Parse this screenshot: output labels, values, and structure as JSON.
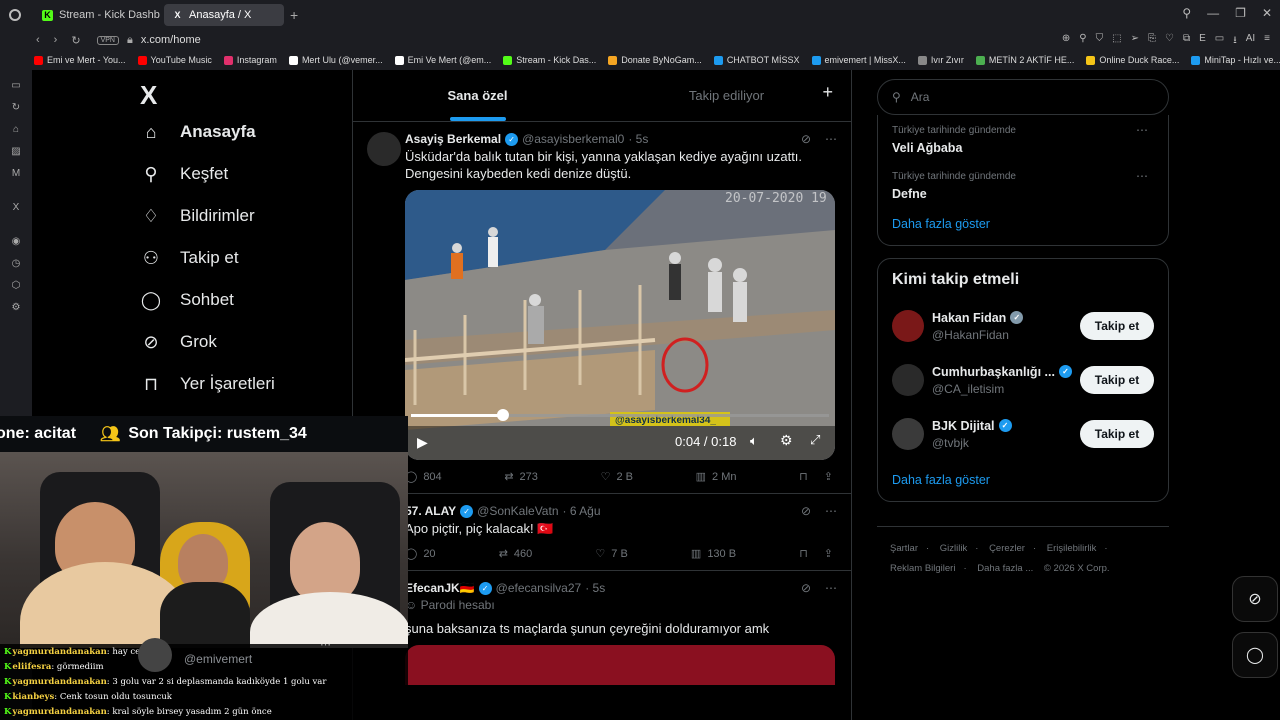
{
  "browser": {
    "tabs": [
      {
        "label": "Stream - Kick Dashboard",
        "fav": "K",
        "color": "#53fc18"
      },
      {
        "label": "Anasayfa / X",
        "fav": "X",
        "color": "#ffffff"
      }
    ],
    "url": "x.com/home",
    "vpn": "VPN",
    "bookmarks": [
      {
        "label": "Emi ve Mert - You...",
        "color": "#ff0000"
      },
      {
        "label": "YouTube Music",
        "color": "#ff0000"
      },
      {
        "label": "Instagram",
        "color": "#e1306c"
      },
      {
        "label": "Mert Ulu (@vemer...",
        "color": "#ffffff"
      },
      {
        "label": "Emi Ve Mert (@em...",
        "color": "#ffffff"
      },
      {
        "label": "Stream - Kick Das...",
        "color": "#53fc18"
      },
      {
        "label": "Donate ByNoGam...",
        "color": "#f5a623"
      },
      {
        "label": "CHATBOT MİSSX",
        "color": "#1d9bf0"
      },
      {
        "label": "emivemert | MissX...",
        "color": "#1d9bf0"
      },
      {
        "label": "Ivır Zıvır",
        "color": "#888888"
      },
      {
        "label": "METİN 2 AKTİF HE...",
        "color": "#4caf50"
      },
      {
        "label": "Online Duck Race...",
        "color": "#f5c518"
      },
      {
        "label": "MiniTap - Hızlı ve...",
        "color": "#1d9bf0"
      }
    ]
  },
  "nav": {
    "logo": "X",
    "items": [
      {
        "label": "Anasayfa",
        "icon": "home-icon",
        "glyph": "⌂"
      },
      {
        "label": "Keşfet",
        "icon": "search-icon",
        "glyph": "⚲"
      },
      {
        "label": "Bildirimler",
        "icon": "bell-icon",
        "glyph": "♢"
      },
      {
        "label": "Takip et",
        "icon": "follow-icon",
        "glyph": "⁺"
      },
      {
        "label": "Sohbet",
        "icon": "chat-icon",
        "glyph": "◯"
      },
      {
        "label": "Grok",
        "icon": "grok-icon",
        "glyph": "⊘"
      },
      {
        "label": "Yer İşaretleri",
        "icon": "bookmark-icon",
        "glyph": "⊓"
      }
    ]
  },
  "timeline": {
    "tabs": [
      "Sana özel",
      "Takip ediliyor"
    ],
    "posts": [
      {
        "name": "Asayiş Berkemal",
        "handle": "@asayisberkemal0",
        "time": "· 5s",
        "text": "Üsküdar'da balık tutan bir kişi, yanına yaklaşan kediye ayağını uzattı. Dengesini kaybeden kedi denize düştü.",
        "video_watermark": "@asayisberkemal34_",
        "video_time": "0:04 / 0:18",
        "video_date": "20-07-2020 19",
        "progress": 0.22,
        "stats": {
          "replies": "804",
          "reposts": "273",
          "likes": "2 B",
          "views": "2 Mn"
        }
      },
      {
        "name": "57. ALAY",
        "handle": "@SonKaleVatn",
        "time": "· 6 Ağu",
        "text": "Apo piçtir, piç kalacak! 🇹🇷",
        "stats": {
          "replies": "20",
          "reposts": "460",
          "likes": "7 B",
          "views": "130 B"
        }
      },
      {
        "name": "EfecanJK🇩🇪",
        "handle": "@efecansilva27",
        "time": "· 5s",
        "label": "Parodi hesabı",
        "text": "şuna baksanıza ts maçlarda şunun çeyreğini dolduramıyor amk"
      }
    ]
  },
  "right": {
    "search_placeholder": "Ara",
    "trends": [
      {
        "context": "Türkiye tarihinde gündemde",
        "name": "Veli Ağbaba"
      },
      {
        "context": "Türkiye tarihinde gündemde",
        "name": "Defne"
      }
    ],
    "show_more": "Daha fazla göster",
    "who_to_follow": "Kimi takip etmeli",
    "follow": [
      {
        "name": "Hakan Fidan",
        "handle": "@HakanFidan",
        "badge": "gray"
      },
      {
        "name": "Cumhurbaşkanlığı ...",
        "handle": "@CA_iletisim",
        "badge": "blue"
      },
      {
        "name": "BJK Dijital",
        "handle": "@tvbjk",
        "badge": "blue"
      }
    ],
    "follow_btn": "Takip et",
    "footer": [
      "Şartlar",
      "Gizlilik",
      "Çerezler",
      "Erişilebilirlik",
      "Reklam Bilgileri",
      "Daha fazla ...",
      "© 2026 X Corp."
    ]
  },
  "stream": {
    "ticker1": "one: acitat",
    "ticker2": "Son Takipçi: rustem_34",
    "mini_handle": "@emivemert",
    "chat": [
      {
        "user": "yagmurdandanakan",
        "msg": "hay cenk"
      },
      {
        "user": "eliifesra",
        "msg": "görmediim"
      },
      {
        "user": "yagmurdandanakan",
        "msg": "3 golu var 2 si deplasmanda kadıköyde 1 golu var"
      },
      {
        "user": "kianbeys",
        "msg": "Cenk tosun oldu tosuncuk"
      },
      {
        "user": "yagmurdandanakan",
        "msg": "kral söyle birsey yasadım 2 gün önce"
      }
    ]
  }
}
